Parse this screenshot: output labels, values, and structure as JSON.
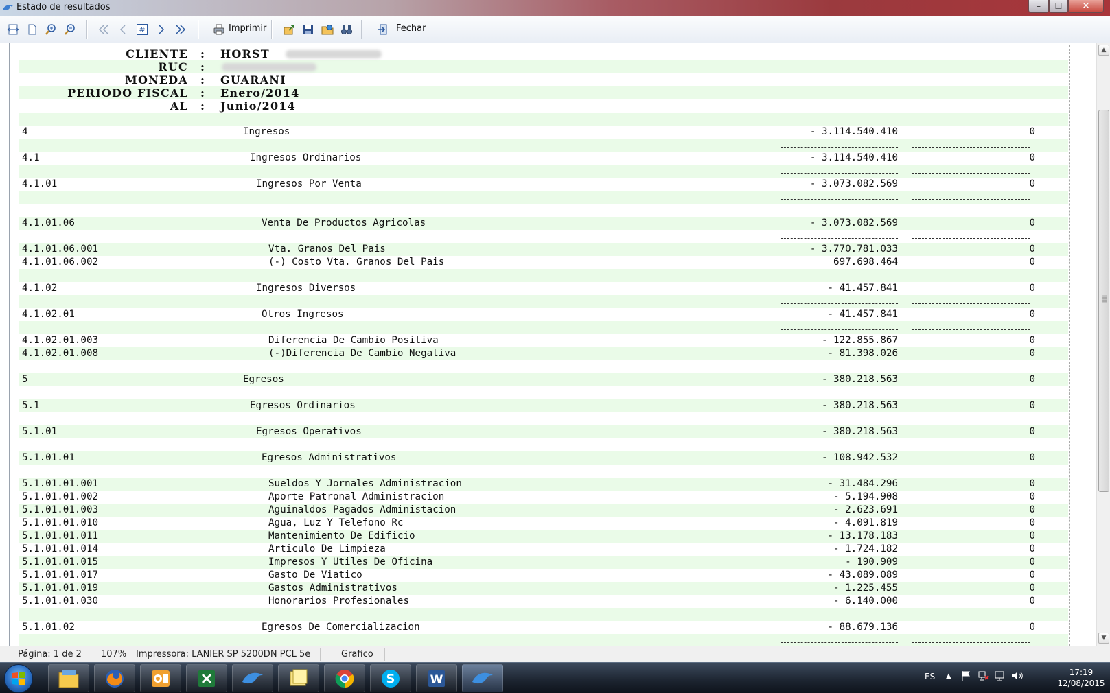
{
  "window": {
    "title": "Estado de resultados",
    "min": "–",
    "max": "☐",
    "close": "✕"
  },
  "toolbar": {
    "print_label": "Imprimir",
    "close_label": "Fechar"
  },
  "header": [
    {
      "label": "CLIENTE",
      "value": "HORST",
      "blurred": true
    },
    {
      "label": "RUC",
      "value": "",
      "blurred": true
    },
    {
      "label": "MONEDA",
      "value": "GUARANI",
      "blurred": false
    },
    {
      "label": "PERIODO FISCAL",
      "value": "Enero/2014",
      "blurred": false
    },
    {
      "label": "AL",
      "value": "Junio/2014",
      "blurred": false
    }
  ],
  "rows": [
    {
      "code": "4",
      "desc": "Ingresos",
      "level": 0,
      "amount": "- 3.114.540.410",
      "amount2": "0",
      "dash_after": true
    },
    {
      "code": "4.1",
      "desc": "Ingresos Ordinarios",
      "level": 1,
      "amount": "- 3.114.540.410",
      "amount2": "0",
      "dash_after": true
    },
    {
      "code": "4.1.01",
      "desc": "Ingresos Por Venta",
      "level": 2,
      "amount": "- 3.073.082.569",
      "amount2": "0",
      "dash_after": true,
      "extra_gap": true
    },
    {
      "code": "4.1.01.06",
      "desc": "Venta De Productos Agricolas",
      "level": 3,
      "amount": "- 3.073.082.569",
      "amount2": "0",
      "dash_after": true
    },
    {
      "code": "4.1.01.06.001",
      "desc": "Vta. Granos Del Pais",
      "level": 4,
      "amount": "- 3.770.781.033",
      "amount2": "0"
    },
    {
      "code": "4.1.01.06.002",
      "desc": "(-) Costo Vta. Granos Del Pais",
      "level": 4,
      "amount": "697.698.464",
      "amount2": "0",
      "gap_after": true
    },
    {
      "code": "4.1.02",
      "desc": "Ingresos Diversos",
      "level": 2,
      "amount": "- 41.457.841",
      "amount2": "0",
      "dash_after": true
    },
    {
      "code": "4.1.02.01",
      "desc": "Otros Ingresos",
      "level": 3,
      "amount": "- 41.457.841",
      "amount2": "0",
      "dash_after": true
    },
    {
      "code": "4.1.02.01.003",
      "desc": "Diferencia De Cambio Positiva",
      "level": 4,
      "amount": "- 122.855.867",
      "amount2": "0"
    },
    {
      "code": "4.1.02.01.008",
      "desc": "(-)Diferencia De Cambio Negativa",
      "level": 4,
      "amount": "- 81.398.026",
      "amount2": "0",
      "gap_after": true
    },
    {
      "code": "5",
      "desc": "Egresos",
      "level": 0,
      "amount": "- 380.218.563",
      "amount2": "0",
      "dash_after": true
    },
    {
      "code": "5.1",
      "desc": "Egresos Ordinarios",
      "level": 1,
      "amount": "- 380.218.563",
      "amount2": "0",
      "dash_after": true
    },
    {
      "code": "5.1.01",
      "desc": "Egresos Operativos",
      "level": 2,
      "amount": "- 380.218.563",
      "amount2": "0",
      "dash_after": true
    },
    {
      "code": "5.1.01.01",
      "desc": "Egresos Administrativos",
      "level": 3,
      "amount": "- 108.942.532",
      "amount2": "0",
      "dash_after": true
    },
    {
      "code": "5.1.01.01.001",
      "desc": "Sueldos Y Jornales Administracion",
      "level": 4,
      "amount": "- 31.484.296",
      "amount2": "0"
    },
    {
      "code": "5.1.01.01.002",
      "desc": "Aporte Patronal Administracion",
      "level": 4,
      "amount": "- 5.194.908",
      "amount2": "0"
    },
    {
      "code": "5.1.01.01.003",
      "desc": "Aguinaldos Pagados Administacion",
      "level": 4,
      "amount": "- 2.623.691",
      "amount2": "0"
    },
    {
      "code": "5.1.01.01.010",
      "desc": "Agua, Luz Y Telefono Rc",
      "level": 4,
      "amount": "- 4.091.819",
      "amount2": "0"
    },
    {
      "code": "5.1.01.01.011",
      "desc": "Mantenimiento De Edificio",
      "level": 4,
      "amount": "- 13.178.183",
      "amount2": "0"
    },
    {
      "code": "5.1.01.01.014",
      "desc": "Articulo De Limpieza",
      "level": 4,
      "amount": "- 1.724.182",
      "amount2": "0"
    },
    {
      "code": "5.1.01.01.015",
      "desc": "Impresos Y Utiles De Oficina",
      "level": 4,
      "amount": "- 190.909",
      "amount2": "0"
    },
    {
      "code": "5.1.01.01.017",
      "desc": "Gasto De Viatico",
      "level": 4,
      "amount": "- 43.089.089",
      "amount2": "0"
    },
    {
      "code": "5.1.01.01.019",
      "desc": "Gastos Administrativos",
      "level": 4,
      "amount": "- 1.225.455",
      "amount2": "0"
    },
    {
      "code": "5.1.01.01.030",
      "desc": "Honorarios Profesionales",
      "level": 4,
      "amount": "- 6.140.000",
      "amount2": "0",
      "gap_after": true
    },
    {
      "code": "5.1.01.02",
      "desc": "Egresos De Comercializacion",
      "level": 3,
      "amount": "- 88.679.136",
      "amount2": "0",
      "dash_after": true
    }
  ],
  "statusbar": {
    "page": "Página: 1 de 2",
    "zoom": "107%",
    "printer": "Impressora: LANIER SP 5200DN PCL 5e",
    "mode": "Grafico"
  },
  "taskbar": {
    "lang": "ES",
    "time": "17:19",
    "date": "12/08/2015"
  }
}
